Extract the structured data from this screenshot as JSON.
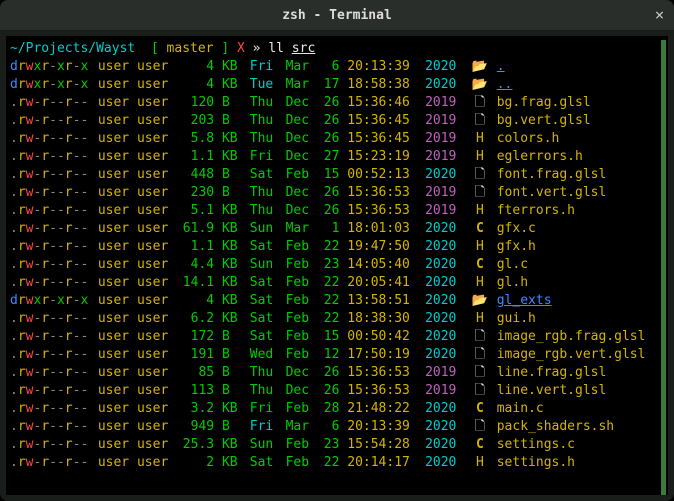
{
  "window": {
    "title": "zsh - Terminal"
  },
  "prompt": {
    "path": "~/Projects/Wayst",
    "branch_open": "[",
    "branch": " master ",
    "branch_close": "]",
    "mark": "X",
    "sep": "»",
    "cmd": "ll",
    "arg": "src"
  },
  "rows": [
    {
      "perm": "drwxr-xr-x",
      "owner": "user",
      "group": "user",
      "size": "4",
      "unit": "KB",
      "wday": "Fri",
      "wcls": "wday-cyan",
      "mon": "Mar",
      "mday": "6",
      "time": "20:13:39",
      "year": "2020",
      "ycls": "year-cyan",
      "icon": "📂",
      "icls": "icon-folder",
      "name": ".",
      "ncls": "fdir",
      "pcls": "blue"
    },
    {
      "perm": "drwxr-xr-x",
      "owner": "user",
      "group": "user",
      "size": "4",
      "unit": "KB",
      "wday": "Tue",
      "wcls": "wday-cyan",
      "mon": "Mar",
      "mday": "17",
      "time": "18:58:38",
      "year": "2020",
      "ycls": "year-cyan",
      "icon": "📂",
      "icls": "icon-folder",
      "name": "..",
      "ncls": "fdir",
      "pcls": "blue"
    },
    {
      "perm": ".rw-r--r--",
      "owner": "user",
      "group": "user",
      "size": "120",
      "unit": "B",
      "wday": "Thu",
      "wcls": "wday-green",
      "mon": "Dec",
      "mday": "26",
      "time": "15:36:46",
      "year": "2019",
      "ycls": "year-mag",
      "icon": "🗋",
      "icls": "icon-file",
      "name": "bg.frag.glsl",
      "ncls": "freg",
      "pcls": "yellow"
    },
    {
      "perm": ".rw-r--r--",
      "owner": "user",
      "group": "user",
      "size": "203",
      "unit": "B",
      "wday": "Thu",
      "wcls": "wday-green",
      "mon": "Dec",
      "mday": "26",
      "time": "15:36:45",
      "year": "2019",
      "ycls": "year-mag",
      "icon": "🗋",
      "icls": "icon-file",
      "name": "bg.vert.glsl",
      "ncls": "freg",
      "pcls": "yellow"
    },
    {
      "perm": ".rw-r--r--",
      "owner": "user",
      "group": "user",
      "size": "5.8",
      "unit": "KB",
      "wday": "Thu",
      "wcls": "wday-green",
      "mon": "Dec",
      "mday": "26",
      "time": "15:36:45",
      "year": "2019",
      "ycls": "year-mag",
      "icon": "H",
      "icls": "icon-h",
      "name": "colors.h",
      "ncls": "freg",
      "pcls": "yellow"
    },
    {
      "perm": ".rw-r--r--",
      "owner": "user",
      "group": "user",
      "size": "1.1",
      "unit": "KB",
      "wday": "Fri",
      "wcls": "wday-green",
      "mon": "Dec",
      "mday": "27",
      "time": "15:23:19",
      "year": "2019",
      "ycls": "year-mag",
      "icon": "H",
      "icls": "icon-h",
      "name": "eglerrors.h",
      "ncls": "freg",
      "pcls": "yellow"
    },
    {
      "perm": ".rw-r--r--",
      "owner": "user",
      "group": "user",
      "size": "448",
      "unit": "B",
      "wday": "Sat",
      "wcls": "wday-green",
      "mon": "Feb",
      "mday": "15",
      "time": "00:52:13",
      "year": "2020",
      "ycls": "year-cyan",
      "icon": "🗋",
      "icls": "icon-file",
      "name": "font.frag.glsl",
      "ncls": "freg",
      "pcls": "yellow"
    },
    {
      "perm": ".rw-r--r--",
      "owner": "user",
      "group": "user",
      "size": "230",
      "unit": "B",
      "wday": "Thu",
      "wcls": "wday-green",
      "mon": "Dec",
      "mday": "26",
      "time": "15:36:53",
      "year": "2019",
      "ycls": "year-mag",
      "icon": "🗋",
      "icls": "icon-file",
      "name": "font.vert.glsl",
      "ncls": "freg",
      "pcls": "yellow"
    },
    {
      "perm": ".rw-r--r--",
      "owner": "user",
      "group": "user",
      "size": "5.1",
      "unit": "KB",
      "wday": "Thu",
      "wcls": "wday-green",
      "mon": "Dec",
      "mday": "26",
      "time": "15:36:53",
      "year": "2019",
      "ycls": "year-mag",
      "icon": "H",
      "icls": "icon-h",
      "name": "fterrors.h",
      "ncls": "freg",
      "pcls": "yellow"
    },
    {
      "perm": ".rw-r--r--",
      "owner": "user",
      "group": "user",
      "size": "61.9",
      "unit": "KB",
      "wday": "Sun",
      "wcls": "wday-green",
      "mon": "Mar",
      "mday": "1",
      "time": "18:01:03",
      "year": "2020",
      "ycls": "year-cyan",
      "icon": "C",
      "icls": "icon-c",
      "name": "gfx.c",
      "ncls": "freg",
      "pcls": "yellow"
    },
    {
      "perm": ".rw-r--r--",
      "owner": "user",
      "group": "user",
      "size": "1.1",
      "unit": "KB",
      "wday": "Sat",
      "wcls": "wday-green",
      "mon": "Feb",
      "mday": "22",
      "time": "19:47:50",
      "year": "2020",
      "ycls": "year-cyan",
      "icon": "H",
      "icls": "icon-h",
      "name": "gfx.h",
      "ncls": "freg",
      "pcls": "yellow"
    },
    {
      "perm": ".rw-r--r--",
      "owner": "user",
      "group": "user",
      "size": "4.4",
      "unit": "KB",
      "wday": "Sun",
      "wcls": "wday-green",
      "mon": "Feb",
      "mday": "23",
      "time": "14:05:40",
      "year": "2020",
      "ycls": "year-cyan",
      "icon": "C",
      "icls": "icon-c",
      "name": "gl.c",
      "ncls": "freg",
      "pcls": "yellow"
    },
    {
      "perm": ".rw-r--r--",
      "owner": "user",
      "group": "user",
      "size": "14.1",
      "unit": "KB",
      "wday": "Sat",
      "wcls": "wday-green",
      "mon": "Feb",
      "mday": "22",
      "time": "20:05:41",
      "year": "2020",
      "ycls": "year-cyan",
      "icon": "H",
      "icls": "icon-h",
      "name": "gl.h",
      "ncls": "freg",
      "pcls": "yellow"
    },
    {
      "perm": "drwxr-xr-x",
      "owner": "user",
      "group": "user",
      "size": "4",
      "unit": "KB",
      "wday": "Sat",
      "wcls": "wday-green",
      "mon": "Feb",
      "mday": "22",
      "time": "13:58:51",
      "year": "2020",
      "ycls": "year-cyan",
      "icon": "📂",
      "icls": "icon-folder",
      "name": "gl_exts",
      "ncls": "fdir",
      "pcls": "blue"
    },
    {
      "perm": ".rw-r--r--",
      "owner": "user",
      "group": "user",
      "size": "6.2",
      "unit": "KB",
      "wday": "Sat",
      "wcls": "wday-green",
      "mon": "Feb",
      "mday": "22",
      "time": "18:38:30",
      "year": "2020",
      "ycls": "year-cyan",
      "icon": "H",
      "icls": "icon-h",
      "name": "gui.h",
      "ncls": "freg",
      "pcls": "yellow"
    },
    {
      "perm": ".rw-r--r--",
      "owner": "user",
      "group": "user",
      "size": "172",
      "unit": "B",
      "wday": "Sat",
      "wcls": "wday-green",
      "mon": "Feb",
      "mday": "15",
      "time": "00:50:42",
      "year": "2020",
      "ycls": "year-cyan",
      "icon": "🗋",
      "icls": "icon-file",
      "name": "image_rgb.frag.glsl",
      "ncls": "freg",
      "pcls": "yellow"
    },
    {
      "perm": ".rw-r--r--",
      "owner": "user",
      "group": "user",
      "size": "191",
      "unit": "B",
      "wday": "Wed",
      "wcls": "wday-green",
      "mon": "Feb",
      "mday": "12",
      "time": "17:50:19",
      "year": "2020",
      "ycls": "year-cyan",
      "icon": "🗋",
      "icls": "icon-file",
      "name": "image_rgb.vert.glsl",
      "ncls": "freg",
      "pcls": "yellow"
    },
    {
      "perm": ".rw-r--r--",
      "owner": "user",
      "group": "user",
      "size": "85",
      "unit": "B",
      "wday": "Thu",
      "wcls": "wday-green",
      "mon": "Dec",
      "mday": "26",
      "time": "15:36:53",
      "year": "2019",
      "ycls": "year-mag",
      "icon": "🗋",
      "icls": "icon-file",
      "name": "line.frag.glsl",
      "ncls": "freg",
      "pcls": "yellow"
    },
    {
      "perm": ".rw-r--r--",
      "owner": "user",
      "group": "user",
      "size": "113",
      "unit": "B",
      "wday": "Thu",
      "wcls": "wday-green",
      "mon": "Dec",
      "mday": "26",
      "time": "15:36:53",
      "year": "2019",
      "ycls": "year-mag",
      "icon": "🗋",
      "icls": "icon-file",
      "name": "line.vert.glsl",
      "ncls": "freg",
      "pcls": "yellow"
    },
    {
      "perm": ".rw-r--r--",
      "owner": "user",
      "group": "user",
      "size": "3.2",
      "unit": "KB",
      "wday": "Fri",
      "wcls": "wday-green",
      "mon": "Feb",
      "mday": "28",
      "time": "21:48:22",
      "year": "2020",
      "ycls": "year-cyan",
      "icon": "C",
      "icls": "icon-c",
      "name": "main.c",
      "ncls": "freg",
      "pcls": "yellow"
    },
    {
      "perm": ".rw-r--r--",
      "owner": "user",
      "group": "user",
      "size": "949",
      "unit": "B",
      "wday": "Fri",
      "wcls": "wday-cyan",
      "mon": "Mar",
      "mday": "6",
      "time": "20:13:39",
      "year": "2020",
      "ycls": "year-cyan",
      "icon": "🗋",
      "icls": "icon-file",
      "name": "pack_shaders.sh",
      "ncls": "freg",
      "pcls": "yellow"
    },
    {
      "perm": ".rw-r--r--",
      "owner": "user",
      "group": "user",
      "size": "25.3",
      "unit": "KB",
      "wday": "Sun",
      "wcls": "wday-green",
      "mon": "Feb",
      "mday": "23",
      "time": "15:54:28",
      "year": "2020",
      "ycls": "year-cyan",
      "icon": "C",
      "icls": "icon-c",
      "name": "settings.c",
      "ncls": "freg",
      "pcls": "yellow"
    },
    {
      "perm": ".rw-r--r--",
      "owner": "user",
      "group": "user",
      "size": "2",
      "unit": "KB",
      "wday": "Sat",
      "wcls": "wday-green",
      "mon": "Feb",
      "mday": "22",
      "time": "20:14:17",
      "year": "2020",
      "ycls": "year-cyan",
      "icon": "H",
      "icls": "icon-h",
      "name": "settings.h",
      "ncls": "freg",
      "pcls": "yellow"
    }
  ]
}
